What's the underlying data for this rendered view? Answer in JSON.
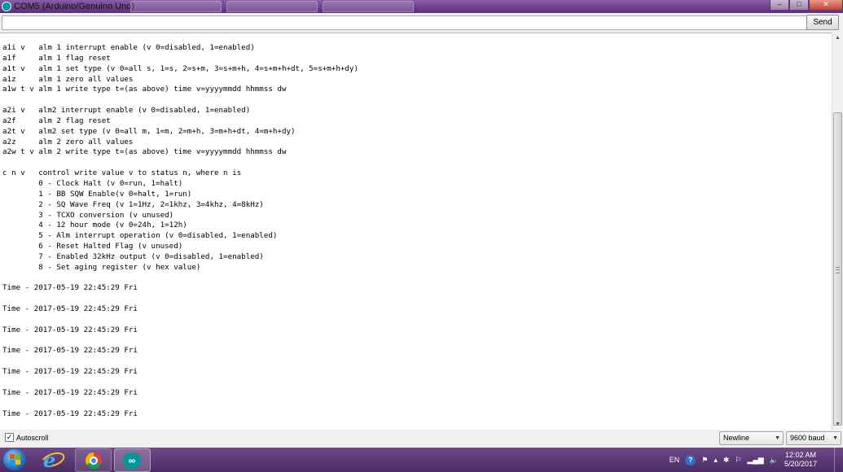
{
  "window": {
    "title": "COM5 (Arduino/Genuino Uno)",
    "controls": [
      "–",
      "□",
      "✕"
    ]
  },
  "send_bar": {
    "input_value": "",
    "send_label": "Send"
  },
  "serial_output": {
    "lines": [
      "a1i v   alm 1 interrupt enable (v 0=disabled, 1=enabled)",
      "a1f     alm 1 flag reset",
      "a1t v   alm 1 set type (v 0=all s, 1=s, 2=s+m, 3=s+m+h, 4=s+m+h+dt, 5=s+m+h+dy)",
      "a1z     alm 1 zero all values",
      "a1w t v alm 1 write type t=(as above) time v=yyyymmdd hhmmss dw",
      "",
      "a2i v   alm2 interrupt enable (v 0=disabled, 1=enabled)",
      "a2f     alm 2 flag reset",
      "a2t v   alm2 set type (v 0=all m, 1=m, 2=m+h, 3=m+h+dt, 4=m+h+dy)",
      "a2z     alm 2 zero all values",
      "a2w t v alm 2 write type t=(as above) time v=yyyymmdd hhmmss dw",
      "",
      "c n v   control write value v to status n, where n is",
      "        0 - Clock Halt (v 0=run, 1=halt)",
      "        1 - BB SQW Enable(v 0=halt, 1=run)",
      "        2 - SQ Wave Freq (v 1=1Hz, 2=1khz, 3=4khz, 4=8kHz)",
      "        3 - TCXO conversion (v unused)",
      "        4 - 12 hour mode (v 0=24h, 1=12h)",
      "        5 - Alm interrupt operation (v 0=disabled, 1=enabled)",
      "        6 - Reset Halted Flag (v unused)",
      "        7 - Enabled 32kHz output (v 0=disabled, 1=enabled)",
      "        8 - Set aging register (v hex value)",
      "",
      "Time - 2017-05-19 22:45:29 Fri",
      "",
      "Time - 2017-05-19 22:45:29 Fri",
      "",
      "Time - 2017-05-19 22:45:29 Fri",
      "",
      "Time - 2017-05-19 22:45:29 Fri",
      "",
      "Time - 2017-05-19 22:45:29 Fri",
      "",
      "Time - 2017-05-19 22:45:29 Fri",
      "",
      "Time - 2017-05-19 22:45:29 Fri"
    ]
  },
  "footer": {
    "autoscroll_label": "Autoscroll",
    "autoscroll_checked": true,
    "line_ending": "Newline",
    "baud_rate": "9600 baud"
  },
  "taskbar": {
    "apps": [
      "internet-explorer",
      "chrome",
      "arduino"
    ],
    "language": "EN",
    "time": "12:02 AM",
    "date": "5/20/2017"
  },
  "colors": {
    "titlebar": "#6b3f8a",
    "taskbar": "#4b2b63",
    "arduino_teal": "#00979c"
  }
}
